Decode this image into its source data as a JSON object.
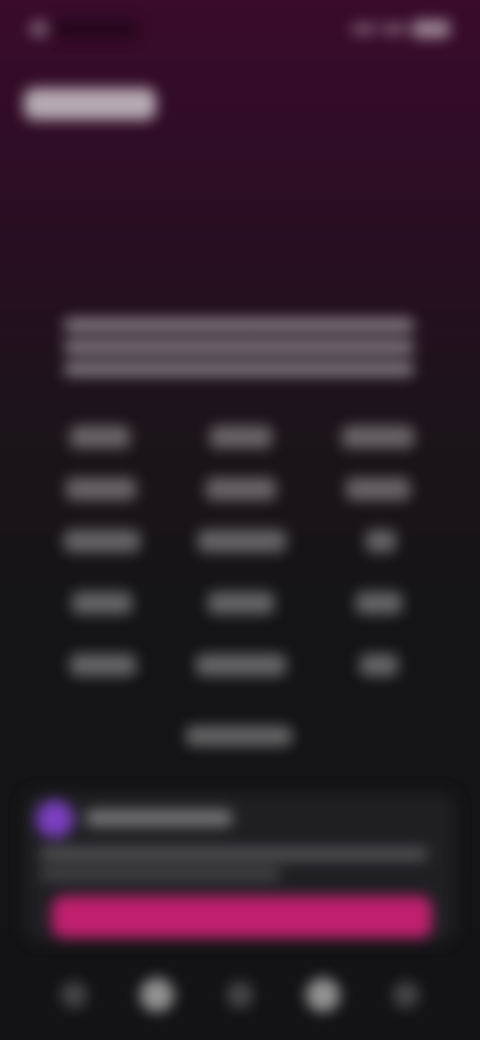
{
  "header": {
    "title": "",
    "subtitle": ""
  },
  "content": {
    "description_lines_count": 3
  },
  "grid": {
    "rows": 5,
    "columns": 3
  },
  "card": {
    "avatar_color": "#7a3fbf",
    "cta_color": "#c0206f"
  },
  "nav": {
    "items": [
      "home-icon",
      "library-icon",
      "search-icon",
      "profile-icon",
      "more-icon"
    ]
  }
}
